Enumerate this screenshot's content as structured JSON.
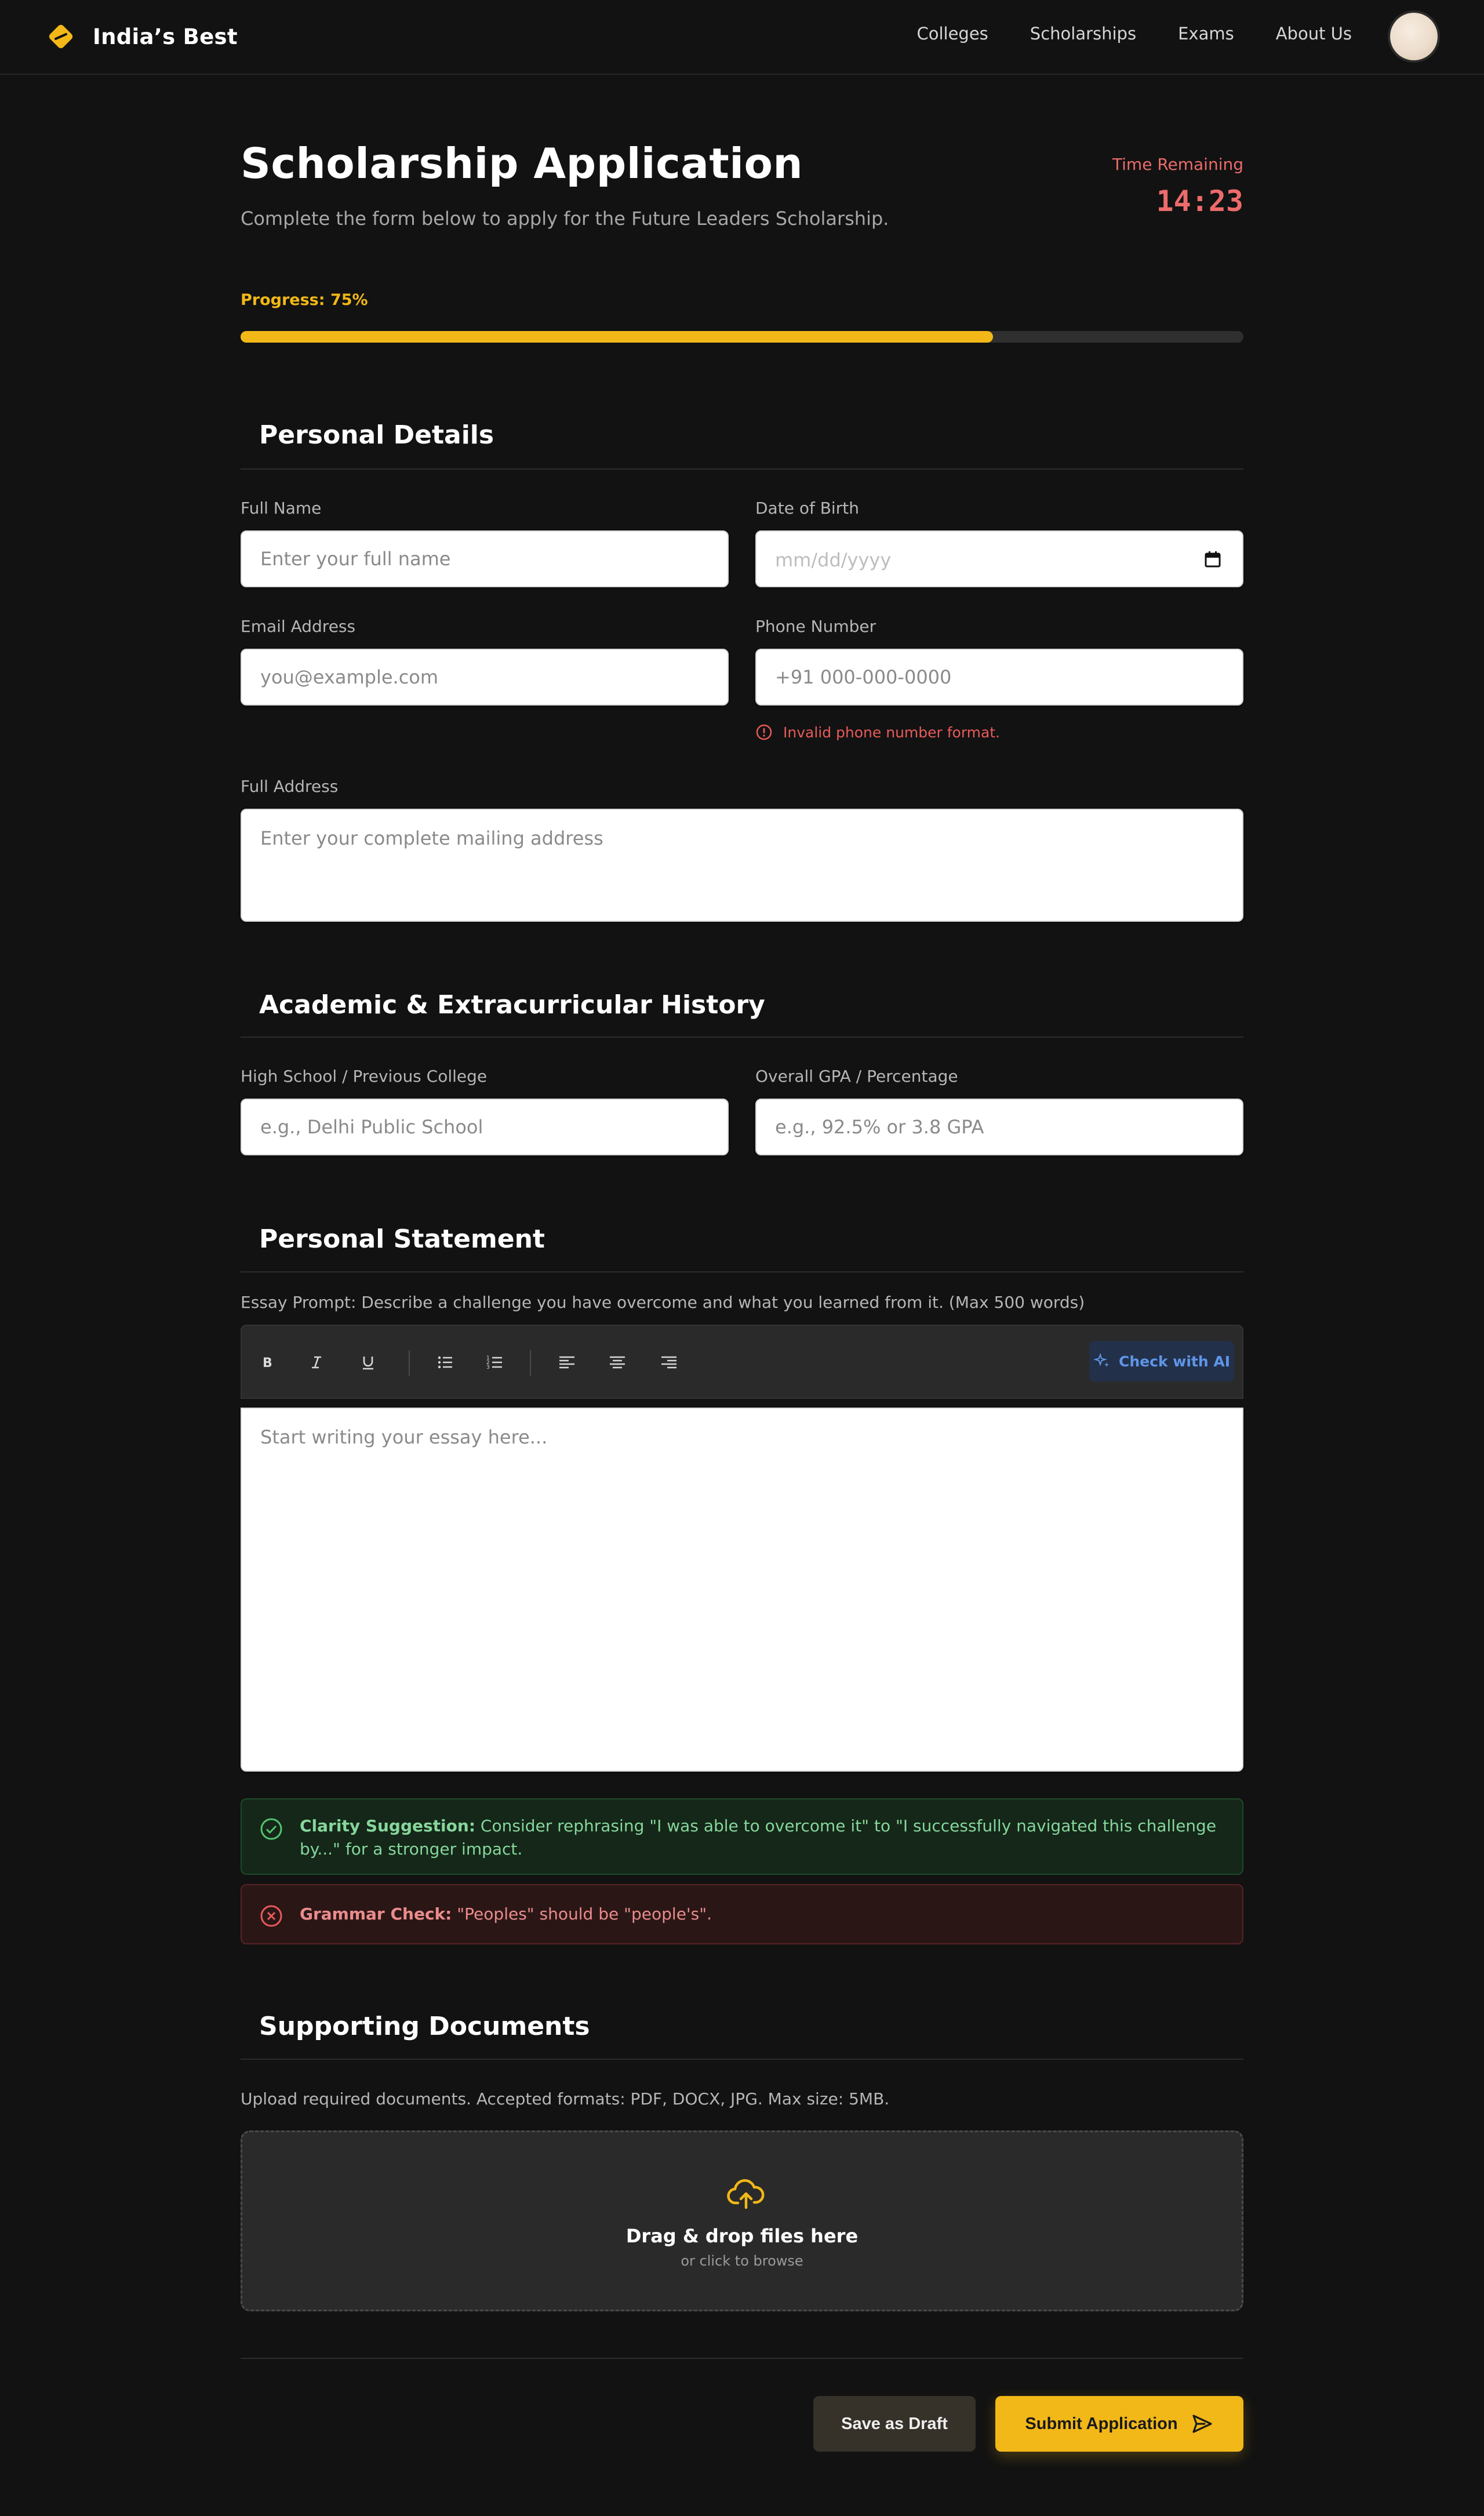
{
  "nav": {
    "brand": "India’s Best",
    "links": [
      "Colleges",
      "Scholarships",
      "Exams",
      "About Us"
    ]
  },
  "header": {
    "title": "Scholarship Application",
    "subtitle": "Complete the form below to apply for the Future Leaders Scholarship.",
    "timer_label": "Time Remaining",
    "timer_value": "14:23"
  },
  "progress": {
    "label": "Progress: 75%",
    "percent": 75
  },
  "personal": {
    "title": "Personal Details",
    "full_name_label": "Full Name",
    "full_name_placeholder": "Enter your full name",
    "dob_label": "Date of Birth",
    "dob_placeholder": "mm/dd/yyyy",
    "email_label": "Email Address",
    "email_placeholder": "you@example.com",
    "phone_label": "Phone Number",
    "phone_placeholder": "+91 000-000-0000",
    "phone_error": "Invalid phone number format.",
    "address_label": "Full Address",
    "address_placeholder": "Enter your complete mailing address"
  },
  "academic": {
    "title": "Academic & Extracurricular History",
    "school_label": "High School / Previous College",
    "school_placeholder": "e.g., Delhi Public School",
    "gpa_label": "Overall GPA / Percentage",
    "gpa_placeholder": "e.g., 92.5% or 3.8 GPA"
  },
  "statement": {
    "title": "Personal Statement",
    "prompt": "Essay Prompt: Describe a challenge you have overcome and what you learned from it. (Max 500 words)",
    "ai_button": "Check with AI",
    "essay_placeholder": "Start writing your essay here...",
    "clarity_head": "Clarity Suggestion:",
    "clarity_text": " Consider rephrasing \"I was able to overcome it\" to \"I successfully navigated this challenge by...\" for a stronger impact.",
    "grammar_head": "Grammar Check:",
    "grammar_text": " \"Peoples\" should be \"people's\"."
  },
  "documents": {
    "title": "Supporting Documents",
    "note": "Upload required documents. Accepted formats: PDF, DOCX, JPG. Max size: 5MB.",
    "drop_title": "Drag & drop files here",
    "drop_sub": "or click to browse"
  },
  "actions": {
    "draft": "Save as Draft",
    "submit": "Submit Application"
  },
  "colors": {
    "accent": "#f2b818",
    "error": "#ec6b6b",
    "success": "#86d69b",
    "background": "#121212"
  }
}
